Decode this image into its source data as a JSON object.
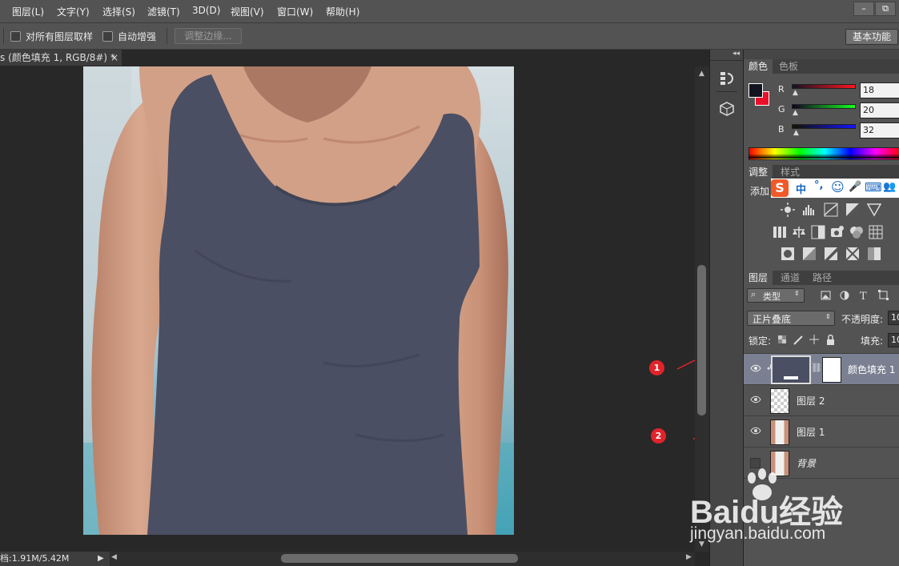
{
  "menu": [
    "图层(L)",
    "文字(Y)",
    "选择(S)",
    "滤镜(T)",
    "3D(D)",
    "视图(V)",
    "窗口(W)",
    "帮助(H)"
  ],
  "window_buttons": [
    "–",
    "⧉"
  ],
  "options": {
    "sample_all_label": "对所有图层取样",
    "auto_enhance_label": "自动增强",
    "refine_edge_label": "调整边缘...",
    "workspace_label": "基本功能"
  },
  "doc_tab": {
    "title": "s (颜色填充 1, RGB/8#) *",
    "close": "×"
  },
  "status": {
    "doc_size": "档:1.91M/5.42M"
  },
  "dock": {
    "collapse_arrows": "◂◂"
  },
  "color_panel": {
    "tabs": [
      "颜色",
      "色板"
    ],
    "channels": [
      {
        "name": "R",
        "value": "18"
      },
      {
        "name": "G",
        "value": "20"
      },
      {
        "name": "B",
        "value": "32"
      }
    ],
    "fg_color": "#121420",
    "bg_color": "#e8102a"
  },
  "adjust_panel": {
    "tabs": [
      "调整",
      "样式"
    ],
    "add_label": "添加"
  },
  "ime_bar": {
    "items": [
      "中",
      "°,",
      "☺",
      "🎤",
      "⌨",
      "👥"
    ]
  },
  "layers_panel": {
    "tabs": [
      "图层",
      "通道",
      "路径"
    ],
    "filter_type": "类型",
    "blend_mode": "正片叠底",
    "opacity_label": "不透明度:",
    "opacity_value": "10",
    "lock_label": "锁定:",
    "fill_label": "填充:",
    "fill_value": "10",
    "layers": [
      {
        "name": "颜色填充 1",
        "visible": true,
        "selected": true
      },
      {
        "name": "图层 2",
        "visible": true,
        "selected": false
      },
      {
        "name": "图层 1",
        "visible": true,
        "selected": false
      },
      {
        "name": "背景",
        "visible": false,
        "selected": false
      }
    ]
  },
  "annotations": [
    "1",
    "2"
  ],
  "watermark": {
    "brand": "Baidu经验",
    "url": "jingyan.baidu.com"
  },
  "colors": {
    "accent_red": "#e0242b",
    "shirt": "#4b4f63",
    "panel": "#535353"
  }
}
